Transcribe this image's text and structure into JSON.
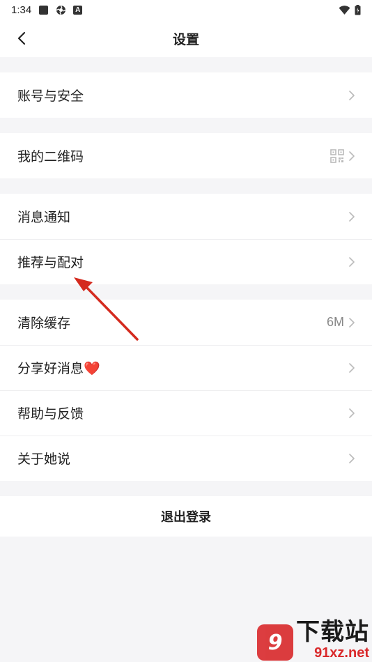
{
  "status_bar": {
    "time": "1:34",
    "badge": "A"
  },
  "header": {
    "title": "设置"
  },
  "groups": [
    {
      "items": [
        {
          "label": "账号与安全"
        }
      ]
    },
    {
      "items": [
        {
          "label": "我的二维码",
          "icon": "qr-code-icon"
        }
      ]
    },
    {
      "items": [
        {
          "label": "消息通知"
        },
        {
          "label": "推荐与配对"
        }
      ]
    },
    {
      "items": [
        {
          "label": "清除缓存",
          "value": "6M"
        },
        {
          "label": "分享好消息❤️"
        },
        {
          "label": "帮助与反馈"
        },
        {
          "label": "关于她说"
        }
      ]
    }
  ],
  "logout": {
    "label": "退出登录"
  },
  "watermark": {
    "title": "下载站",
    "domain": "91xz.net",
    "badge": "9"
  },
  "colors": {
    "background": "#f5f5f7",
    "annotation_arrow": "#d42a1e",
    "watermark_red": "#d9292b"
  }
}
